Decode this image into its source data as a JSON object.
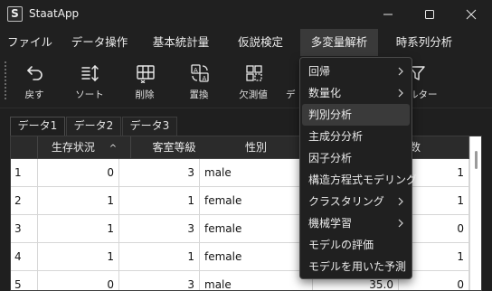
{
  "window": {
    "title": "StaatApp",
    "icon_letter": "S"
  },
  "menu": {
    "items": [
      {
        "label": "ファイル"
      },
      {
        "label": "データ操作"
      },
      {
        "label": "基本統計量"
      },
      {
        "label": "仮説検定"
      },
      {
        "label": "多変量解析"
      },
      {
        "label": "時系列分析"
      }
    ],
    "active_index": 4
  },
  "toolbar": {
    "undo": "戻す",
    "sort": "ソート",
    "delete": "削除",
    "replace": "置換",
    "missing": "欠測値",
    "data_partial": "デ",
    "filter_partial": "ルター"
  },
  "sheets": [
    {
      "label": "データ1"
    },
    {
      "label": "データ2"
    },
    {
      "label": "データ3"
    }
  ],
  "grid": {
    "headers": [
      "生存状況",
      "客室等級",
      "性別",
      "",
      "数"
    ],
    "sort_indicator": "^",
    "rows": [
      {
        "n": "1",
        "survived": "0",
        "pclass": "3",
        "sex": "male",
        "age": "",
        "count": "1"
      },
      {
        "n": "2",
        "survived": "1",
        "pclass": "1",
        "sex": "female",
        "age": "",
        "count": "1"
      },
      {
        "n": "3",
        "survived": "1",
        "pclass": "3",
        "sex": "female",
        "age": "",
        "count": "0"
      },
      {
        "n": "4",
        "survived": "1",
        "pclass": "1",
        "sex": "female",
        "age": "",
        "count": "1"
      },
      {
        "n": "5",
        "survived": "0",
        "pclass": "3",
        "sex": "male",
        "age": "35.0",
        "count": "0"
      }
    ]
  },
  "dropdown": {
    "items": [
      {
        "label": "回帰",
        "submenu": true
      },
      {
        "label": "数量化",
        "submenu": true
      },
      {
        "label": "判別分析",
        "submenu": false
      },
      {
        "label": "主成分分析",
        "submenu": false
      },
      {
        "label": "因子分析",
        "submenu": false
      },
      {
        "label": "構造方程式モデリング",
        "submenu": false
      },
      {
        "label": "クラスタリング",
        "submenu": true
      },
      {
        "label": "機械学習",
        "submenu": true
      },
      {
        "label": "モデルの評価",
        "submenu": false
      },
      {
        "label": "モデルを用いた予測",
        "submenu": false
      }
    ],
    "hover_index": 2
  },
  "colors": {
    "background": "#1f1f1f",
    "menu_hover": "#3a3a3a",
    "grid_header": "#2b2b2b",
    "cell_bg": "#ffffff"
  }
}
